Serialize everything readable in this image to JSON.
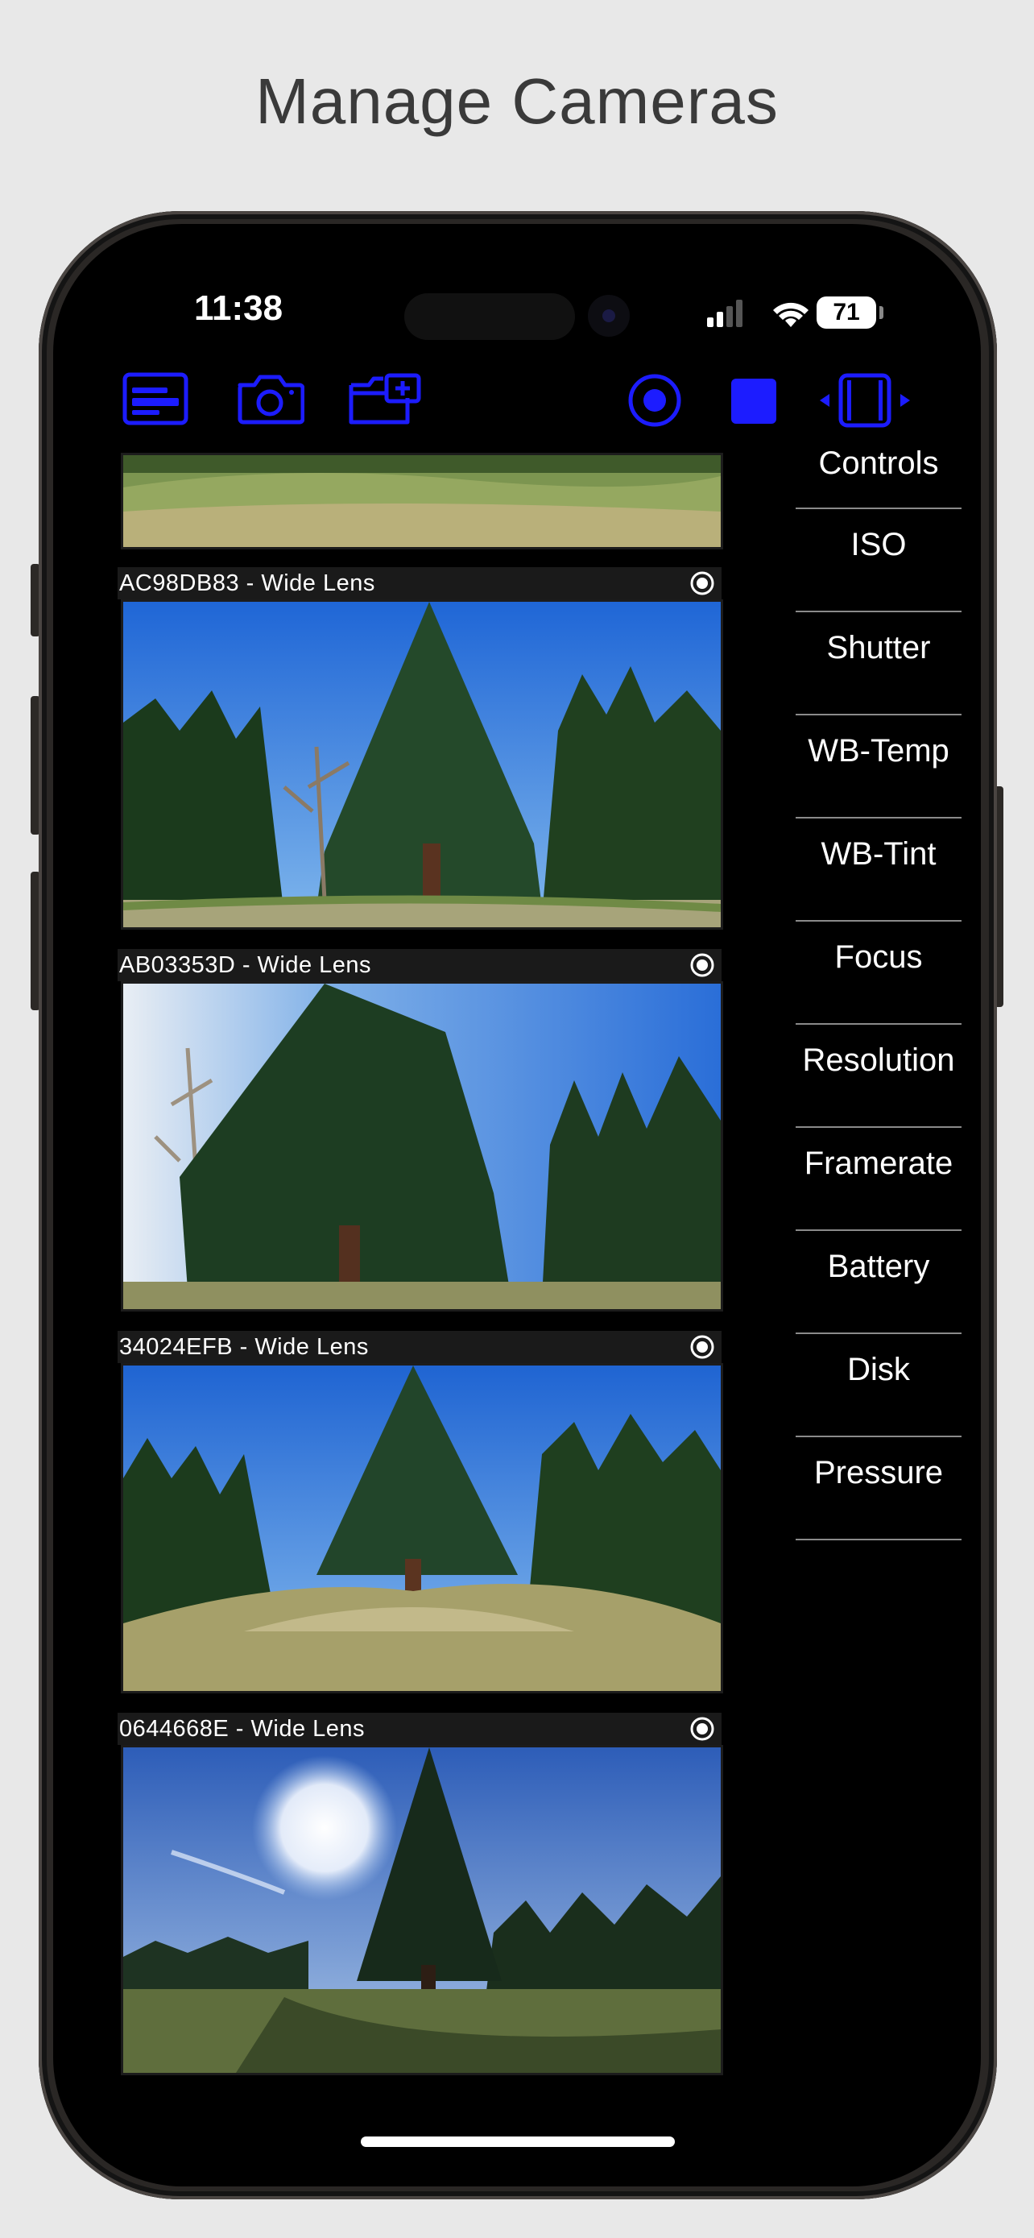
{
  "headline": "Manage Cameras",
  "status_bar": {
    "time": "11:38",
    "battery": "71"
  },
  "toolbar": {
    "accent_color": "#1c1cff",
    "left_icons": [
      "list-icon",
      "camera-icon",
      "folder-add-icon"
    ],
    "right_icons": [
      "record-icon",
      "stop-icon",
      "device-layout-icon"
    ]
  },
  "cameras": [
    {
      "label": "AC98DB83 - Wide Lens"
    },
    {
      "label": "AB03353D - Wide Lens"
    },
    {
      "label": "34024EFB - Wide Lens"
    },
    {
      "label": "0644668E - Wide Lens"
    }
  ],
  "controls": {
    "title": "Controls",
    "items": [
      "ISO",
      "Shutter",
      "WB-Temp",
      "WB-Tint",
      "Focus",
      "Resolution",
      "Framerate",
      "Battery",
      "Disk",
      "Pressure"
    ]
  }
}
